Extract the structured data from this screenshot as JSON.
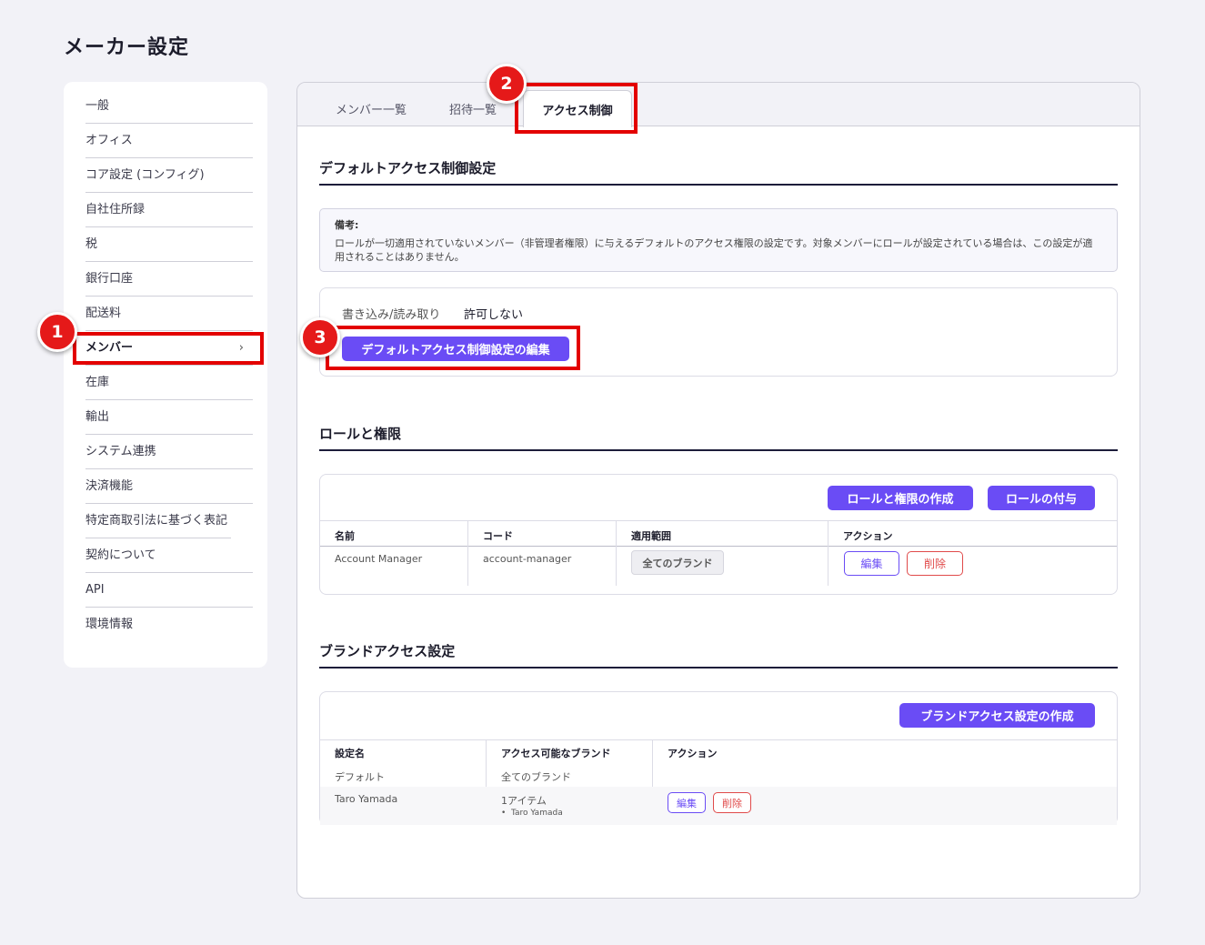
{
  "page": {
    "title": "メーカー設定"
  },
  "sidebar": {
    "items": [
      {
        "label": "一般"
      },
      {
        "label": "オフィス"
      },
      {
        "label": "コア設定 (コンフィグ)"
      },
      {
        "label": "自社住所録"
      },
      {
        "label": "税"
      },
      {
        "label": "銀行口座"
      },
      {
        "label": "配送料"
      },
      {
        "label": "メンバー",
        "active": true
      },
      {
        "label": "在庫"
      },
      {
        "label": "輸出"
      },
      {
        "label": "システム連携"
      },
      {
        "label": "決済機能"
      },
      {
        "label": "特定商取引法に基づく表記"
      },
      {
        "label": "契約について"
      },
      {
        "label": "API"
      },
      {
        "label": "環境情報"
      }
    ],
    "active_chevron": "›"
  },
  "markers": {
    "m1": "1",
    "m2": "2",
    "m3": "3"
  },
  "tabs": [
    {
      "label": "メンバー一覧"
    },
    {
      "label": "招待一覧"
    },
    {
      "label": "アクセス制御",
      "active": true
    }
  ],
  "default_access": {
    "title": "デフォルトアクセス制御設定",
    "note_label": "備考:",
    "note_text": "ロールが一切適用されていないメンバー（非管理者権限）に与えるデフォルトのアクセス権限の設定です。対象メンバーにロールが設定されている場合は、この設定が適用されることはありません。",
    "rw_label": "書き込み/読み取り",
    "rw_value": "許可しない",
    "edit_button": "デフォルトアクセス制御設定の編集"
  },
  "roles": {
    "title": "ロールと権限",
    "create_button": "ロールと権限の作成",
    "assign_button": "ロールの付与",
    "columns": [
      "名前",
      "コード",
      "適用範囲",
      "アクション"
    ],
    "rows": [
      {
        "name": "Account Manager",
        "code": "account-manager",
        "scope": "全てのブランド",
        "edit": "編集",
        "delete": "削除"
      }
    ]
  },
  "brand_access": {
    "title": "ブランドアクセス設定",
    "create_button": "ブランドアクセス設定の作成",
    "columns": [
      "設定名",
      "アクセス可能なブランド",
      "アクション"
    ],
    "rows": [
      {
        "name": "デフォルト",
        "brands": "全てのブランド"
      },
      {
        "name": "Taro Yamada",
        "brands": "1アイテム",
        "brand_items": [
          "Taro Yamada"
        ],
        "edit": "編集",
        "delete": "削除"
      }
    ]
  }
}
